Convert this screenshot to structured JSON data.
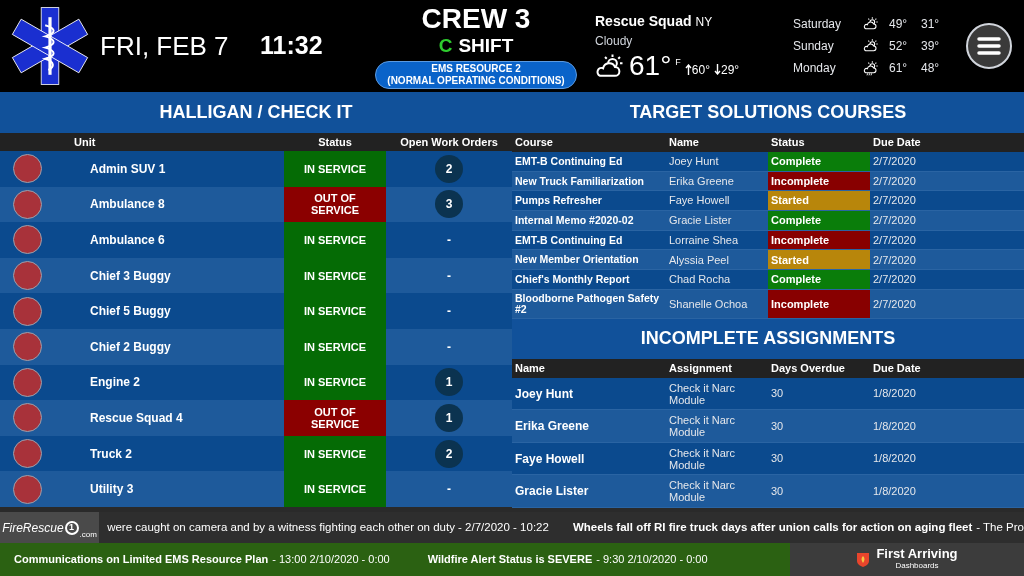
{
  "header": {
    "date": "FRI, FEB 7",
    "time": "11:32",
    "crew": "CREW 3",
    "shift": {
      "letter": "C",
      "label": "SHIFT"
    },
    "resource": [
      "EMS RESOURCE 2",
      "(NORMAL OPERATING CONDITIONS)"
    ]
  },
  "weather": {
    "location": "Rescue Squad",
    "state": "NY",
    "condition": "Cloudy",
    "temp": "61°",
    "unit": "F",
    "high": "60°",
    "low": "29°",
    "forecast": [
      {
        "day": "Saturday",
        "kind": "partly_cloudy",
        "high": "49°",
        "low": "31°"
      },
      {
        "day": "Sunday",
        "kind": "partly_cloudy",
        "high": "52°",
        "low": "39°"
      },
      {
        "day": "Monday",
        "kind": "showers",
        "high": "61°",
        "low": "48°"
      }
    ]
  },
  "units": {
    "title": "HALLIGAN / CHECK IT",
    "columns": [
      "Unit",
      "Status",
      "Open Work Orders"
    ],
    "rows": [
      {
        "name": "Admin SUV 1",
        "status": "IN SERVICE",
        "kind": "in",
        "work_orders": "2",
        "badge": true
      },
      {
        "name": "Ambulance 8",
        "status": "OUT OF SERVICE",
        "kind": "out",
        "work_orders": "3",
        "badge": true
      },
      {
        "name": "Ambulance 6",
        "status": "IN SERVICE",
        "kind": "in",
        "work_orders": "-",
        "badge": false
      },
      {
        "name": "Chief 3 Buggy",
        "status": "IN SERVICE",
        "kind": "in",
        "work_orders": "-",
        "badge": false
      },
      {
        "name": "Chief 5 Buggy",
        "status": "IN SERVICE",
        "kind": "in",
        "work_orders": "-",
        "badge": false
      },
      {
        "name": "Chief 2 Buggy",
        "status": "IN SERVICE",
        "kind": "in",
        "work_orders": "-",
        "badge": false
      },
      {
        "name": "Engine 2",
        "status": "IN SERVICE",
        "kind": "in",
        "work_orders": "1",
        "badge": true
      },
      {
        "name": "Rescue Squad 4",
        "status": "OUT OF SERVICE",
        "kind": "out",
        "work_orders": "1",
        "badge": true
      },
      {
        "name": "Truck 2",
        "status": "IN SERVICE",
        "kind": "in",
        "work_orders": "2",
        "badge": true
      },
      {
        "name": "Utility 3",
        "status": "IN SERVICE",
        "kind": "in",
        "work_orders": "-",
        "badge": false
      }
    ]
  },
  "courses": {
    "title": "TARGET SOLUTIONS COURSES",
    "columns": [
      "Course",
      "Name",
      "Status",
      "Due Date"
    ],
    "rows": [
      {
        "course": "EMT-B Continuing Ed",
        "name": "Joey Hunt",
        "status": "Complete",
        "kind": "complete",
        "due": "2/7/2020"
      },
      {
        "course": "New Truck Familiarization",
        "name": "Erika Greene",
        "status": "Incomplete",
        "kind": "incomplete",
        "due": "2/7/2020"
      },
      {
        "course": "Pumps Refresher",
        "name": "Faye Howell",
        "status": "Started",
        "kind": "started",
        "due": "2/7/2020"
      },
      {
        "course": "Internal Memo #2020-02",
        "name": "Gracie Lister",
        "status": "Complete",
        "kind": "complete",
        "due": "2/7/2020"
      },
      {
        "course": "EMT-B Continuing Ed",
        "name": "Lorraine Shea",
        "status": "Incomplete",
        "kind": "incomplete",
        "due": "2/7/2020"
      },
      {
        "course": "New Member Orientation",
        "name": "Alyssia Peel",
        "status": "Started",
        "kind": "started",
        "due": "2/7/2020"
      },
      {
        "course": "Chief's Monthly Report",
        "name": "Chad Rocha",
        "status": "Complete",
        "kind": "complete",
        "due": "2/7/2020"
      },
      {
        "course": "Bloodborne Pathogen Safety #2",
        "name": "Shanelle Ochoa",
        "status": "Incomplete",
        "kind": "incomplete",
        "due": "2/7/2020"
      }
    ]
  },
  "assignments": {
    "title": "INCOMPLETE ASSIGNMENTS",
    "columns": [
      "Name",
      "Assignment",
      "Days Overdue",
      "Due Date"
    ],
    "rows": [
      {
        "name": "Joey Hunt",
        "assignment": "Check it Narc Module",
        "days": "30",
        "due": "1/8/2020"
      },
      {
        "name": "Erika Greene",
        "assignment": "Check it Narc Module",
        "days": "30",
        "due": "1/8/2020"
      },
      {
        "name": "Faye Howell",
        "assignment": "Check it Narc Module",
        "days": "30",
        "due": "1/8/2020"
      },
      {
        "name": "Gracie Lister",
        "assignment": "Check it Narc Module",
        "days": "30",
        "due": "1/8/2020"
      }
    ]
  },
  "ticker": {
    "logo": {
      "name": "FireRescue",
      "sub": ".com",
      "mark": "1"
    },
    "segments": [
      {
        "text": "were caught on camera and by a witness fighting each other on duty - 2/7/2020 - 10:22",
        "bold": false
      },
      {
        "text": "Wheels fall off RI fire truck days after union calls for action on aging fleet",
        "bold": true
      },
      {
        "text": "- The Pro",
        "bold": false
      }
    ]
  },
  "alerts": [
    {
      "title": "Communications on Limited EMS Resource Plan",
      "meta": "- 13:00 2/10/2020 - 0:00"
    },
    {
      "title": "Wildfire Alert Status is SEVERE",
      "meta": "- 9:30 2/10/2020 - 0:00"
    }
  ],
  "brand": {
    "name": "First Arriving",
    "sub": "Dashboards"
  }
}
